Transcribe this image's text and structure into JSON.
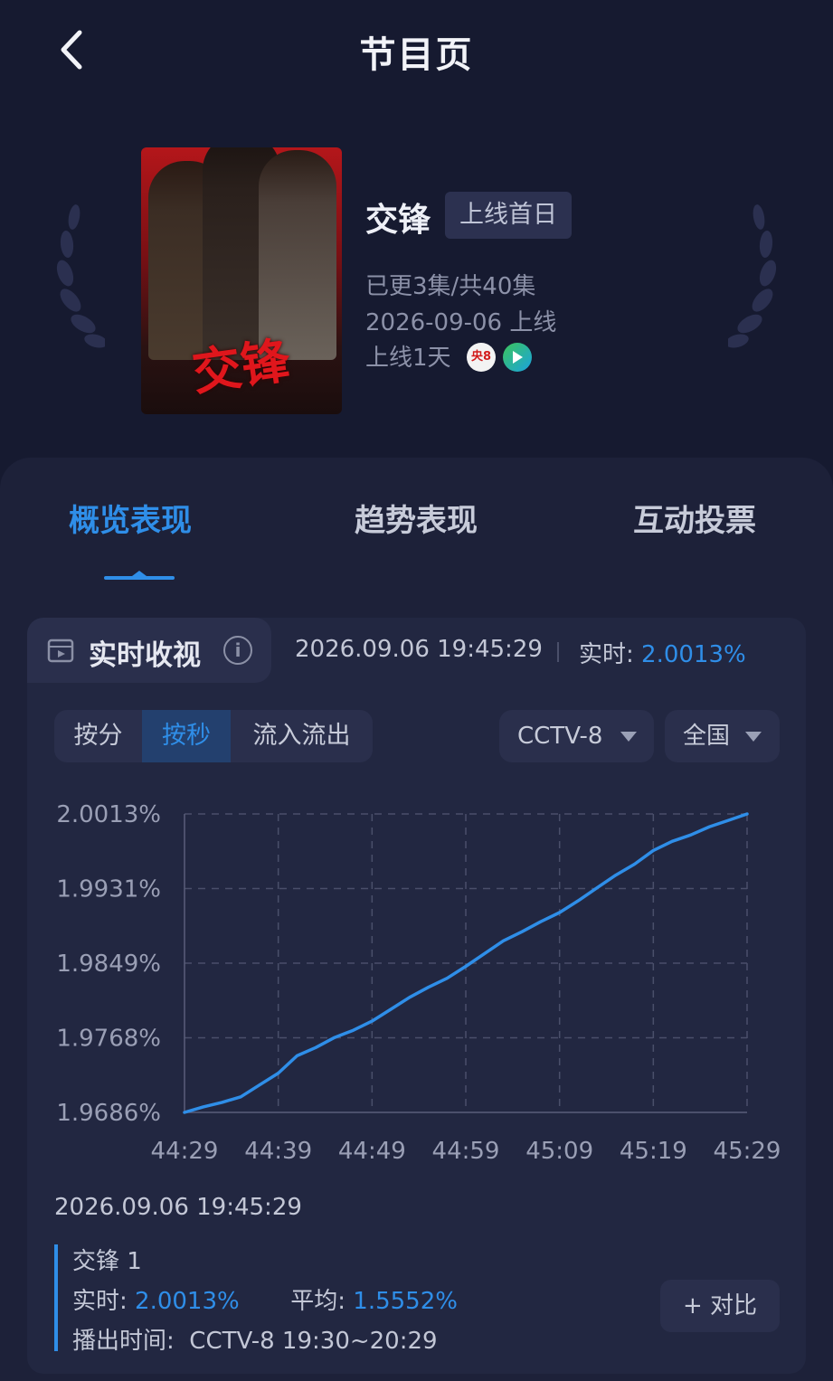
{
  "header": {
    "title": "节目页"
  },
  "show": {
    "title": "交锋",
    "badge": "上线首日",
    "episodes": "已更3集/共40集",
    "release": "2026-09-06 上线",
    "online_days": "上线1天",
    "poster_title": "交锋",
    "platform_icons": [
      "cctv8-icon",
      "play-icon"
    ],
    "cctv8_label": "央8"
  },
  "tabs": [
    {
      "label": "概览表现",
      "active": true
    },
    {
      "label": "趋势表现",
      "active": false
    },
    {
      "label": "互动投票",
      "active": false
    }
  ],
  "realtime": {
    "title": "实时收视",
    "timestamp": "2026.09.06 19:45:29",
    "value_label": "实时: ",
    "value": "2.0013%"
  },
  "segments": [
    {
      "label": "按分",
      "active": false
    },
    {
      "label": "按秒",
      "active": true
    },
    {
      "label": "流入流出",
      "active": false
    }
  ],
  "filters": {
    "channel": "CCTV-8",
    "region": "全国"
  },
  "chart_data": {
    "type": "line",
    "y_ticks": [
      "2.0013%",
      "1.9931%",
      "1.9849%",
      "1.9768%",
      "1.9686%"
    ],
    "ylim": [
      1.9686,
      2.0013
    ],
    "x_ticks": [
      "44:29",
      "44:39",
      "44:49",
      "44:59",
      "45:09",
      "45:19",
      "45:29"
    ],
    "grid": true,
    "series": [
      {
        "values": [
          [
            0,
            1.9686
          ],
          [
            2,
            1.9692
          ],
          [
            4,
            1.9697
          ],
          [
            6,
            1.9703
          ],
          [
            8,
            1.9716
          ],
          [
            10,
            1.9729
          ],
          [
            12,
            1.9748
          ],
          [
            14,
            1.9757
          ],
          [
            16,
            1.9768
          ],
          [
            18,
            1.9776
          ],
          [
            20,
            1.9786
          ],
          [
            22,
            1.9799
          ],
          [
            24,
            1.9812
          ],
          [
            26,
            1.9823
          ],
          [
            28,
            1.9833
          ],
          [
            30,
            1.9846
          ],
          [
            32,
            1.986
          ],
          [
            34,
            1.9874
          ],
          [
            36,
            1.9884
          ],
          [
            38,
            1.9895
          ],
          [
            40,
            1.9905
          ],
          [
            42,
            1.9918
          ],
          [
            44,
            1.9932
          ],
          [
            46,
            1.9946
          ],
          [
            48,
            1.9958
          ],
          [
            50,
            1.9973
          ],
          [
            52,
            1.9983
          ],
          [
            54,
            1.999
          ],
          [
            56,
            1.9999
          ],
          [
            58,
            2.0006
          ],
          [
            60,
            2.0013
          ]
        ]
      }
    ]
  },
  "detail": {
    "timestamp": "2026.09.06 19:45:29",
    "name": "交锋 1",
    "realtime_label": "实时: ",
    "realtime_value": "2.0013%",
    "avg_label": "平均: ",
    "avg_value": "1.5552%",
    "airtime": "播出时间:  CCTV-8 19:30~20:29"
  },
  "compare_button": "+ 对比",
  "colors": {
    "accent": "#2f8ee8",
    "background": "#161a30",
    "card": "#1d2139"
  }
}
